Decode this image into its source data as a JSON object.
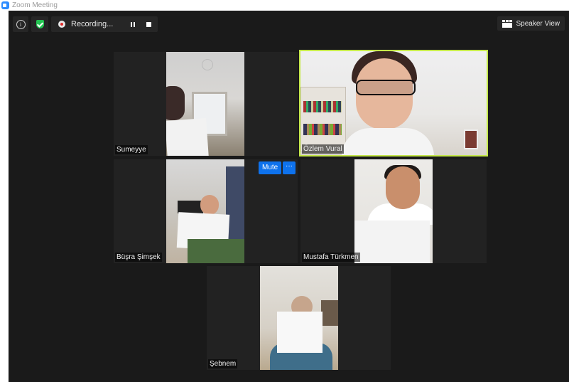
{
  "window": {
    "title": "Zoom Meeting"
  },
  "toolbar": {
    "recording_label": "Recording..."
  },
  "view_button": {
    "label": "Speaker View"
  },
  "participants": [
    {
      "name": "Sumeyye"
    },
    {
      "name": "Özlem Vural"
    },
    {
      "name": "Büşra Şimşek"
    },
    {
      "name": "Mustafa Türkmen"
    },
    {
      "name": "Şebnem"
    }
  ],
  "tile_controls": {
    "mute_label": "Mute",
    "more_label": "···"
  },
  "colors": {
    "active_speaker_border": "#c5e84a",
    "button_blue": "#0e72ed",
    "shield_green": "#23c552",
    "recording_red": "#e02828"
  }
}
